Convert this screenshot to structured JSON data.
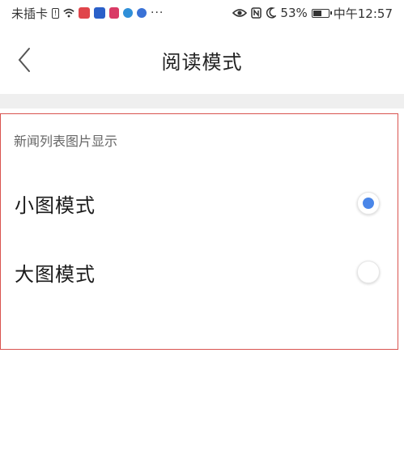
{
  "status_bar": {
    "carrier": "未插卡",
    "more": "···",
    "battery_percent": "53%",
    "time": "中午12:57",
    "battery_level": 0.53
  },
  "header": {
    "title": "阅读模式"
  },
  "section": {
    "title": "新闻列表图片显示",
    "options": [
      {
        "label": "小图模式",
        "selected": true
      },
      {
        "label": "大图模式",
        "selected": false
      }
    ]
  },
  "colors": {
    "accent": "#4a86e8",
    "highlight_border": "#d9534f",
    "band": "#efefef"
  }
}
